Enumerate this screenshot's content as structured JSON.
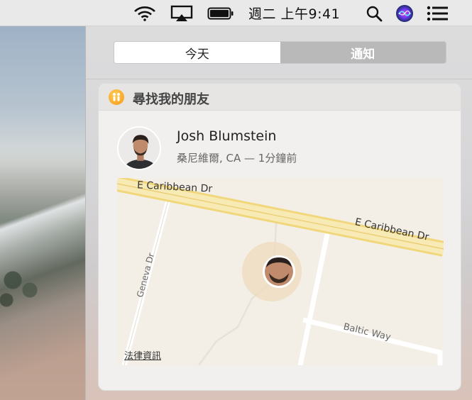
{
  "menubar": {
    "icons": [
      "wifi-icon",
      "airplay-icon",
      "battery-icon",
      "spotlight-search-icon",
      "siri-icon",
      "notification-center-icon"
    ],
    "clock": "週二 上午9:41"
  },
  "tabs": [
    {
      "label": "今天",
      "selected": false
    },
    {
      "label": "通知",
      "selected": true
    }
  ],
  "widget": {
    "title": "尋找我的朋友",
    "friend": {
      "name": "Josh Blumstein",
      "location": "桑尼維爾, CA  —  1分鐘前"
    },
    "map": {
      "streets": [
        "E Caribbean Dr",
        "E Caribbean Dr",
        "Geneva Dr",
        "Baltic Way"
      ],
      "legal_link": "法律資訊"
    }
  },
  "colors": {
    "accent_icon": "#f39a16",
    "selected_tab": "#b9b9b9",
    "map_road": "#f5e2a1",
    "map_bg": "#f3efe6"
  }
}
